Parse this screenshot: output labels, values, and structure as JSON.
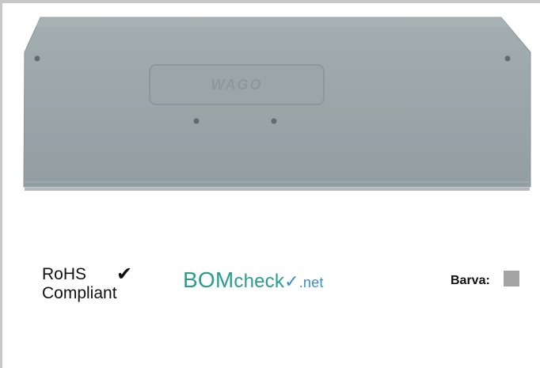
{
  "product": {
    "image_alt": "End and intermediate plate",
    "logo_text": "WAGO",
    "plate_color": "#99a5a8"
  },
  "certifications": {
    "rohs_line1": "RoHS",
    "rohs_line2": "Compliant",
    "rohs_check": "✔",
    "bom_part1": "BOM",
    "bom_part2": "check",
    "bom_tick": "✓",
    "bom_part3": ".net"
  },
  "color": {
    "label": "Barva:",
    "swatch_color": "#a3a3a3"
  }
}
